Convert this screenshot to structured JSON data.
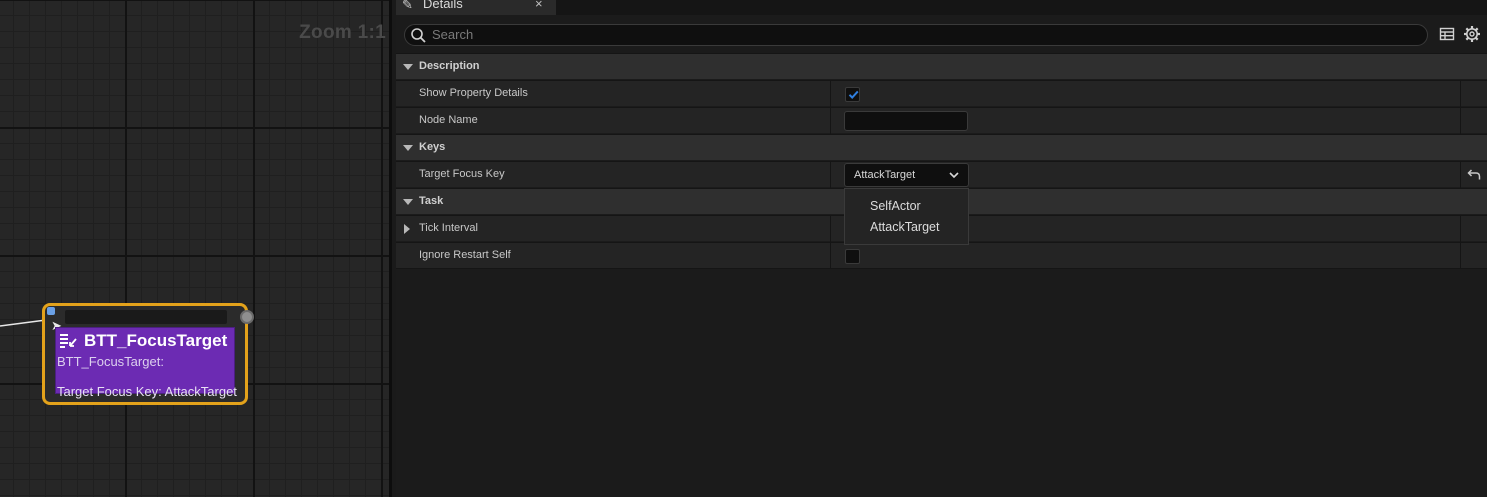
{
  "graph": {
    "zoom_label": "Zoom 1:1",
    "node": {
      "title": "BTT_FocusTarget",
      "subtitle": "BTT_FocusTarget:",
      "description": "Target Focus Key: AttackTarget",
      "border_color": "#e3a21b",
      "body_color": "#6c2bb3"
    }
  },
  "details": {
    "tab": {
      "label": "Details",
      "icon": "pencil-icon",
      "close": "×"
    },
    "search": {
      "placeholder": "Search"
    },
    "toolbar": {
      "grid_icon": "grid-icon",
      "settings_icon": "gear-icon"
    },
    "categories": {
      "description": {
        "label": "Description",
        "show_property_details": {
          "label": "Show Property Details",
          "checked": true
        },
        "node_name": {
          "label": "Node Name",
          "value": ""
        }
      },
      "keys": {
        "label": "Keys",
        "target_focus_key": {
          "label": "Target Focus Key",
          "value": "AttackTarget",
          "options": [
            "SelfActor",
            "AttackTarget"
          ]
        }
      },
      "task": {
        "label": "Task",
        "tick_interval": {
          "label": "Tick Interval"
        },
        "ignore_restart_self": {
          "label": "Ignore Restart Self",
          "checked": false
        }
      }
    },
    "accent_color": "#2f7fe0"
  }
}
